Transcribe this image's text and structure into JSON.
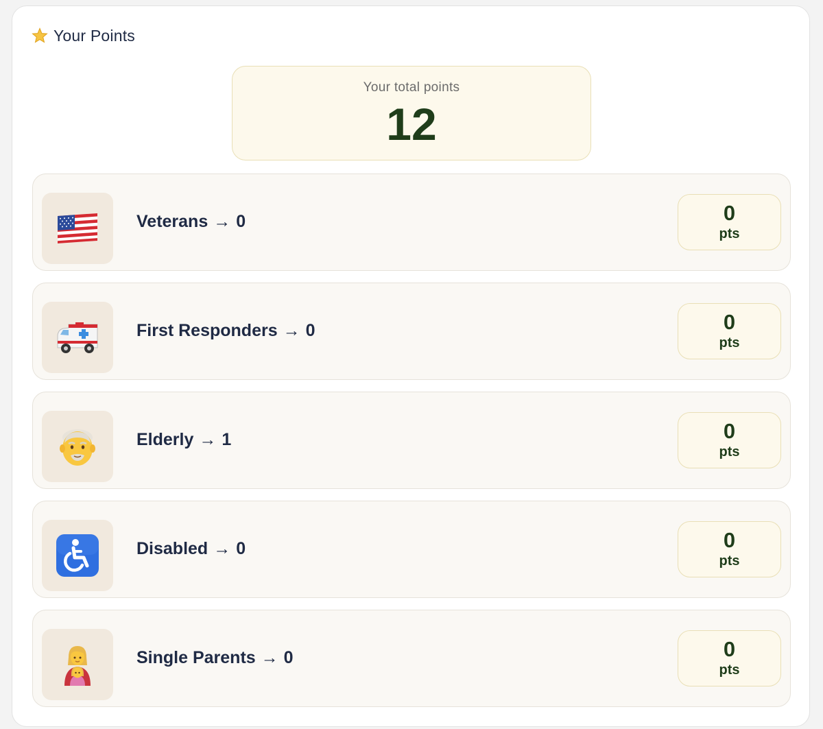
{
  "header": {
    "icon": "star-icon",
    "title": "Your Points"
  },
  "total": {
    "label": "Your total points",
    "value": "12"
  },
  "categories": [
    {
      "icon": "us-flag-icon",
      "name": "Veterans",
      "arrow": "→",
      "count": "0",
      "points": "0",
      "unit": "pts"
    },
    {
      "icon": "ambulance-icon",
      "name": "First Responders",
      "arrow": "→",
      "count": "0",
      "points": "0",
      "unit": "pts"
    },
    {
      "icon": "older-man-icon",
      "name": "Elderly",
      "arrow": "→",
      "count": "1",
      "points": "0",
      "unit": "pts"
    },
    {
      "icon": "wheelchair-icon",
      "name": "Disabled",
      "arrow": "→",
      "count": "0",
      "points": "0",
      "unit": "pts"
    },
    {
      "icon": "mother-child-icon",
      "name": "Single Parents",
      "arrow": "→",
      "count": "0",
      "points": "0",
      "unit": "pts"
    }
  ],
  "colors": {
    "accent_text": "#1f3d1a",
    "highlight_bg": "#fdf9ec",
    "highlight_border": "#e9dfb6",
    "row_bg": "#faf8f4",
    "icon_tile_bg": "#f1e9de",
    "label_text": "#1f2a44"
  }
}
